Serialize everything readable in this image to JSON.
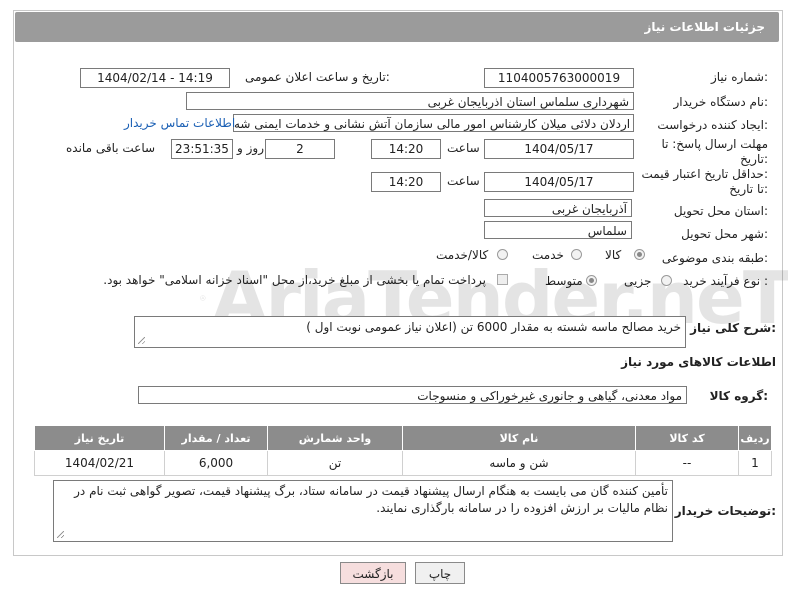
{
  "header": {
    "title": "جزئیات اطلاعات نیاز"
  },
  "watermark": {
    "text": "AriaTender.neT"
  },
  "fields": {
    "need_number": {
      "label": "شماره نیاز:",
      "value": "1104005763000019"
    },
    "announce_datetime": {
      "label": "تاریخ و ساعت اعلان عمومی:",
      "value": "1404/02/14 - 14:19"
    },
    "buyer_org": {
      "label": "نام دستگاه خریدار:",
      "value": "شهرداری سلماس استان اذربایجان غربی"
    },
    "requester": {
      "label": "ایجاد کننده درخواست:",
      "value": "اردلان دلائی میلان کارشناس امور مالی سازمان آتش نشانی و خدمات ایمنی شه",
      "link": "اطلاعات تماس خریدار"
    },
    "reply_deadline": {
      "label_line1": "مهلت ارسال پاسخ: تا",
      "label_line2": "تاریخ:",
      "date": "1404/05/17",
      "time_label": "ساعت",
      "time": "14:20",
      "days": "2",
      "days_label": "روز و",
      "remaining": "23:51:35",
      "remaining_label": "ساعت باقی مانده"
    },
    "price_validity": {
      "label_line1": "حداقل تاریخ اعتبار قیمت:",
      "label_line2": "تا تاریخ:",
      "date": "1404/05/17",
      "time_label": "ساعت",
      "time": "14:20"
    },
    "delivery_province": {
      "label": "استان محل تحویل:",
      "value": "آذربایجان غربی"
    },
    "delivery_city": {
      "label": "شهر محل تحویل:",
      "value": "سلماس"
    },
    "category": {
      "label": "طبقه بندی موضوعی:",
      "options": [
        "کالا",
        "خدمت",
        "کالا/خدمت"
      ],
      "selected": "کالا"
    },
    "purchase_process": {
      "label": "نوع فرآیند خرید :",
      "options": [
        "جزیی",
        "متوسط"
      ],
      "selected": "متوسط",
      "payment_note": "پرداخت تمام یا بخشی از مبلغ خرید،از محل \"اسناد خزانه اسلامی\" خواهد بود."
    }
  },
  "description": {
    "label": "شرح کلی نیاز:",
    "value": "خرید مصالح ماسه شسته به مقدار 6000 تن (اعلان نیاز عمومی نوبت اول )"
  },
  "goods_section": {
    "title": "اطلاعات کالاهای مورد نیاز"
  },
  "goods_group": {
    "label": "گروه کالا:",
    "value": "مواد معدنی، گیاهی و جانوری غیرخوراکی و منسوجات"
  },
  "table": {
    "headers": [
      "ردیف",
      "کد کالا",
      "نام کالا",
      "واحد شمارش",
      "تعداد / مقدار",
      "تاریخ نیاز"
    ],
    "rows": [
      [
        "1",
        "--",
        "شن و ماسه",
        "تن",
        "6,000",
        "1404/02/21"
      ]
    ]
  },
  "buyer_notes": {
    "label": "توضیحات خریدار:",
    "value": "تأمین کننده گان می بایست به هنگام ارسال پیشنهاد قیمت در سامانه ستاد، برگ پیشنهاد قیمت، تصویر گواهی ثبت نام در نظام مالیات بر ارزش افزوده را در سامانه بارگذاری نمایند."
  },
  "buttons": {
    "print": "چاپ",
    "back": "بازگشت"
  }
}
